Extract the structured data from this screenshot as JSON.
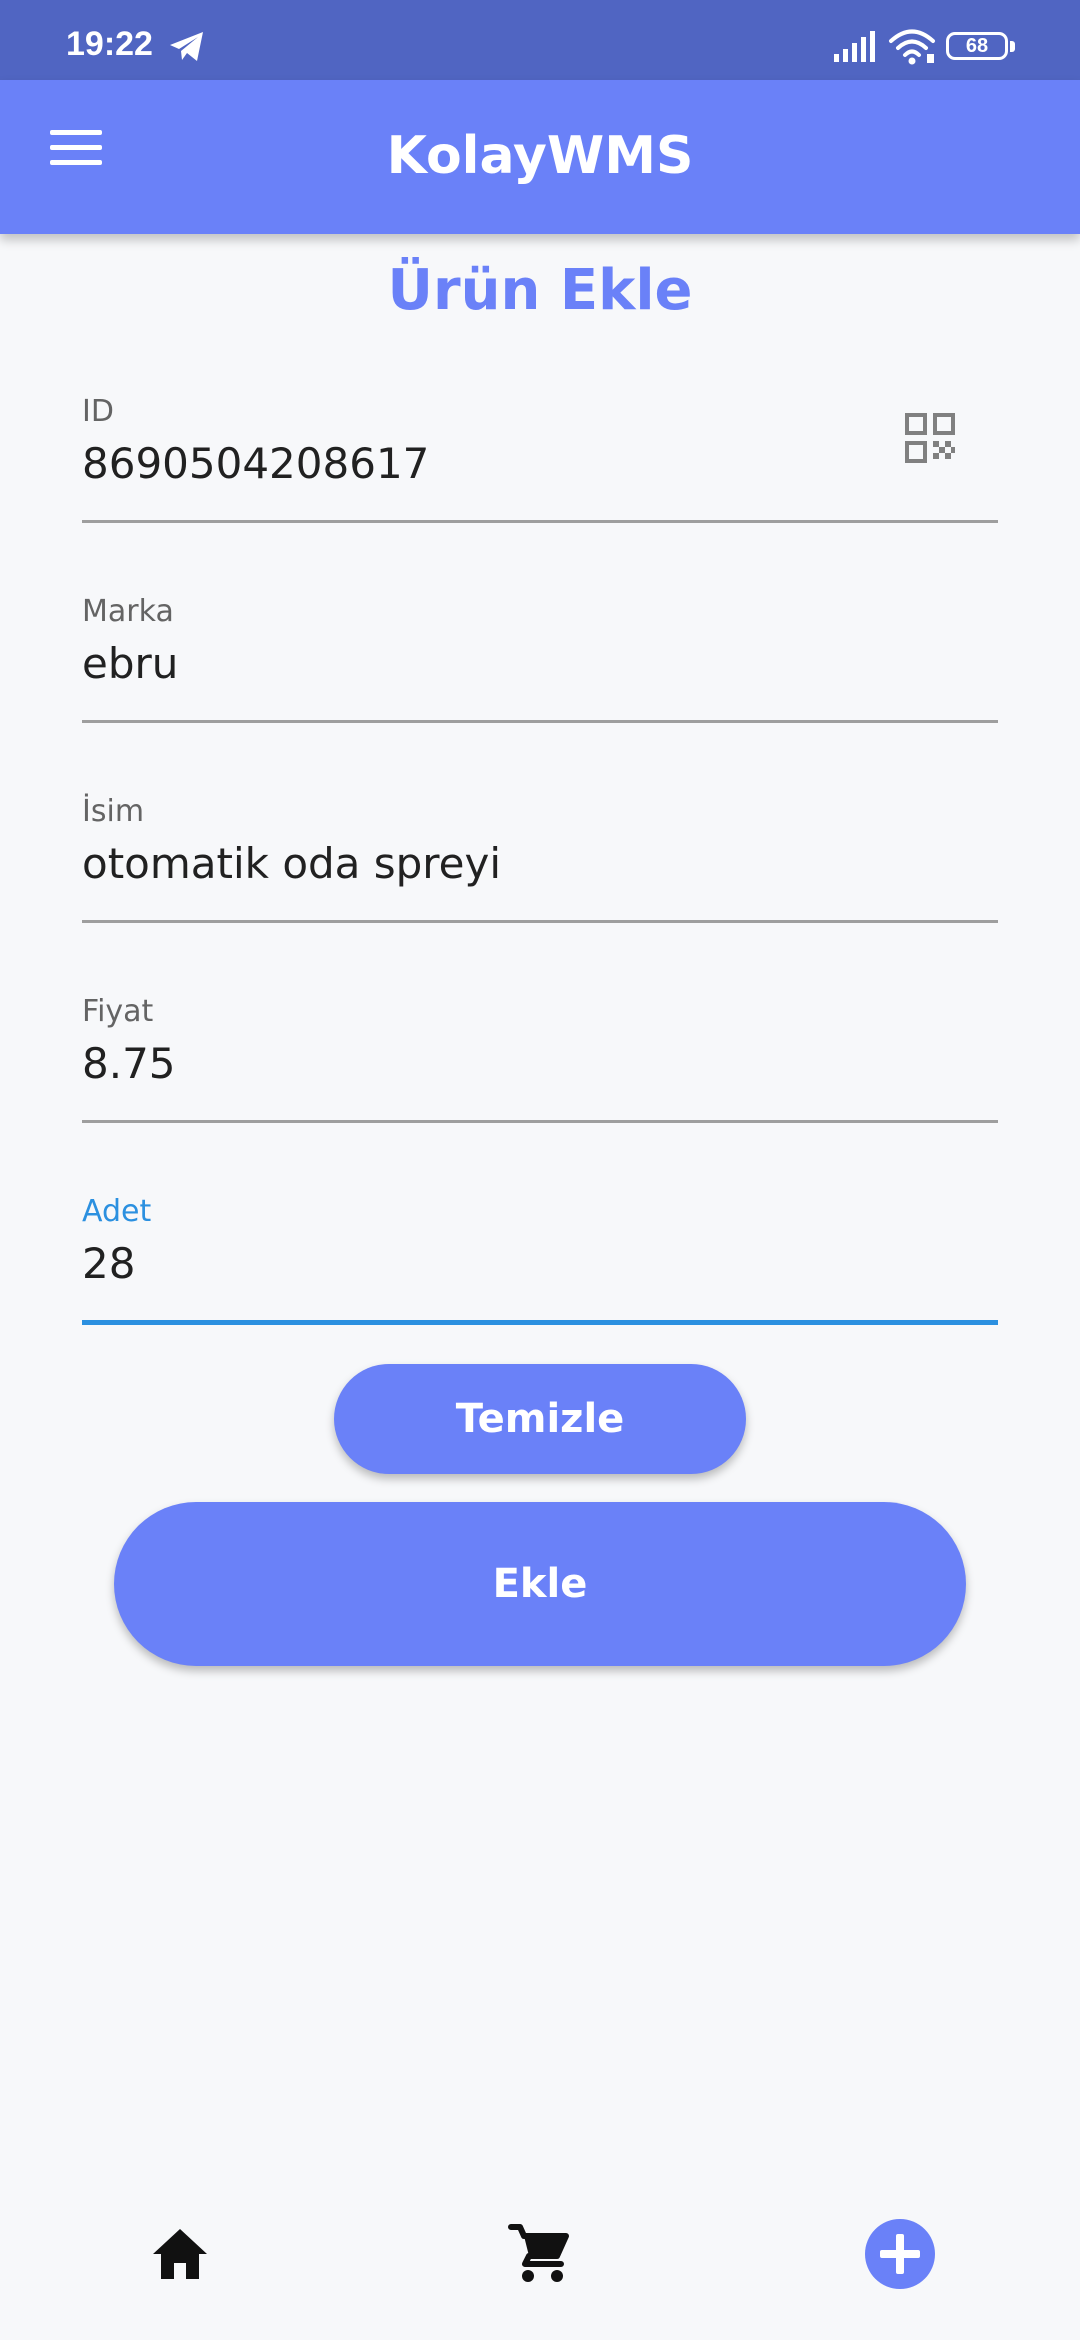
{
  "status_bar": {
    "time": "19:22",
    "battery_level": "68",
    "icons": [
      "telegram-icon",
      "signal-icon",
      "wifi-icon",
      "battery-icon"
    ]
  },
  "app_bar": {
    "title": "KolayWMS",
    "menu_icon": "menu-icon"
  },
  "page": {
    "title": "Ürün Ekle"
  },
  "form": {
    "fields": [
      {
        "label": "ID",
        "value": "8690504208617",
        "trailing_icon": "qr-code-icon"
      },
      {
        "label": "Marka",
        "value": "ebru"
      },
      {
        "label": "İsim",
        "value": "otomatik oda spreyi"
      },
      {
        "label": "Fiyat",
        "value": "8.75"
      },
      {
        "label": "Adet",
        "value": "28",
        "focused": true
      }
    ]
  },
  "buttons": {
    "clear_label": "Temizle",
    "add_label": "Ekle"
  },
  "bottom_nav": {
    "items": [
      "home-icon",
      "cart-icon",
      "add-circle-icon"
    ]
  },
  "colors": {
    "status_bar": "#5065c2",
    "primary": "#6a81f8",
    "focus": "#2b90e0",
    "background": "#f7f8fa",
    "text": "#212121",
    "label": "#646464"
  }
}
